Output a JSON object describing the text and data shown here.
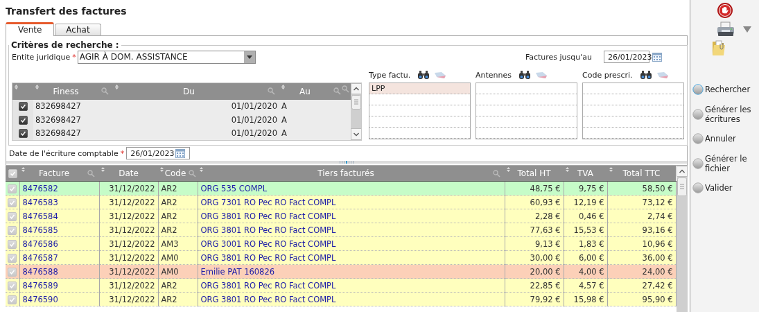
{
  "title": "Transfert des factures",
  "tabs": [
    {
      "label": "Vente",
      "selected": true
    },
    {
      "label": "Achat",
      "selected": false
    }
  ],
  "criteria": {
    "legend": "Critères de recherche :",
    "entity": {
      "label": "Entite juridique",
      "required_mark": "*",
      "value": "AGIR À DOM. ASSISTANCE"
    },
    "invoices_until": {
      "label": "Factures jusqu'au",
      "value": "26/01/2023"
    },
    "finess_grid": {
      "columns": [
        {
          "label": "Finess",
          "searchable": true
        },
        {
          "label": "Du",
          "searchable": true
        },
        {
          "label": "Au",
          "searchable": true
        }
      ],
      "rows": [
        {
          "checked": true,
          "cells": [
            "832698427",
            "01/01/2020",
            "A"
          ]
        },
        {
          "checked": true,
          "cells": [
            "832698427",
            "01/01/2020",
            "A"
          ]
        },
        {
          "checked": true,
          "cells": [
            "832698427",
            "01/01/2020",
            "A"
          ]
        }
      ]
    },
    "pick_lists": [
      {
        "label": "Type factu.",
        "items": [
          {
            "text": "LPP",
            "selected": true
          }
        ]
      },
      {
        "label": "Antennes"
      },
      {
        "label": "Code prescri."
      }
    ]
  },
  "accounting_date": {
    "label": "Date de l'écriture comptable",
    "required_mark": "*",
    "value": "26/01/2023"
  },
  "invoices": {
    "all_checked": true,
    "columns": [
      {
        "label": "Facture",
        "searchable": true
      },
      {
        "label": "Date",
        "searchable": false
      },
      {
        "label": "Code",
        "searchable": true
      },
      {
        "label": "Tiers facturés",
        "searchable": true
      },
      {
        "label": "Total HT",
        "searchable": false
      },
      {
        "label": "TVA",
        "searchable": false
      },
      {
        "label": "Total TTC",
        "searchable": false
      }
    ],
    "rows": [
      {
        "checked": true,
        "color": "#c6fcc8",
        "cells": [
          "8476582",
          "31/12/2022",
          "AR2",
          "ORG 535 COMPL",
          "48,75 €",
          "9,75 €",
          "58,50 €"
        ]
      },
      {
        "checked": true,
        "color": "#ffffbe",
        "cells": [
          "8476583",
          "31/12/2022",
          "AR2",
          "ORG 7301 RO Pec RO Fact COMPL",
          "60,93 €",
          "12,19 €",
          "73,12 €"
        ]
      },
      {
        "checked": true,
        "color": "#ffffbe",
        "cells": [
          "8476584",
          "31/12/2022",
          "AR2",
          "ORG 3801 RO Pec RO Fact COMPL",
          "2,28 €",
          "0,46 €",
          "2,74 €"
        ]
      },
      {
        "checked": true,
        "color": "#ffffbe",
        "cells": [
          "8476585",
          "31/12/2022",
          "AR2",
          "ORG 3801 RO Pec RO Fact COMPL",
          "77,63 €",
          "15,53 €",
          "93,16 €"
        ]
      },
      {
        "checked": true,
        "color": "#ffffbe",
        "cells": [
          "8476586",
          "31/12/2022",
          "AM3",
          "ORG 3001 RO Pec RO Fact COMPL",
          "9,13 €",
          "1,83 €",
          "10,96 €"
        ]
      },
      {
        "checked": true,
        "color": "#ffffbe",
        "cells": [
          "8476587",
          "31/12/2022",
          "AM0",
          "ORG 3801 RO Pec RO Fact COMPL",
          "30,00 €",
          "6,00 €",
          "36,00 €"
        ]
      },
      {
        "checked": true,
        "color": "#fcd0b8",
        "cells": [
          "8476588",
          "31/12/2022",
          "AM0",
          "Emilie PAT 160826",
          "20,00 €",
          "4,00 €",
          "24,00 €"
        ]
      },
      {
        "checked": true,
        "color": "#ffffbe",
        "cells": [
          "8476589",
          "31/12/2022",
          "AR2",
          "ORG 3801 RO Pec RO Fact COMPL",
          "22,85 €",
          "4,57 €",
          "27,42 €"
        ]
      },
      {
        "checked": true,
        "color": "#ffffbe",
        "cells": [
          "8476590",
          "31/12/2022",
          "AR2",
          "ORG 3801 RO Pec RO Fact COMPL",
          "79,92 €",
          "15,98 €",
          "95,90 €"
        ]
      }
    ]
  },
  "actions": [
    {
      "label": "Rechercher",
      "focused": true
    },
    {
      "label": "Générer les écritures",
      "focused": false
    },
    {
      "label": "Annuler",
      "focused": false
    },
    {
      "label": "Générer le fichier",
      "focused": false
    },
    {
      "label": "Valider",
      "focused": false
    }
  ]
}
